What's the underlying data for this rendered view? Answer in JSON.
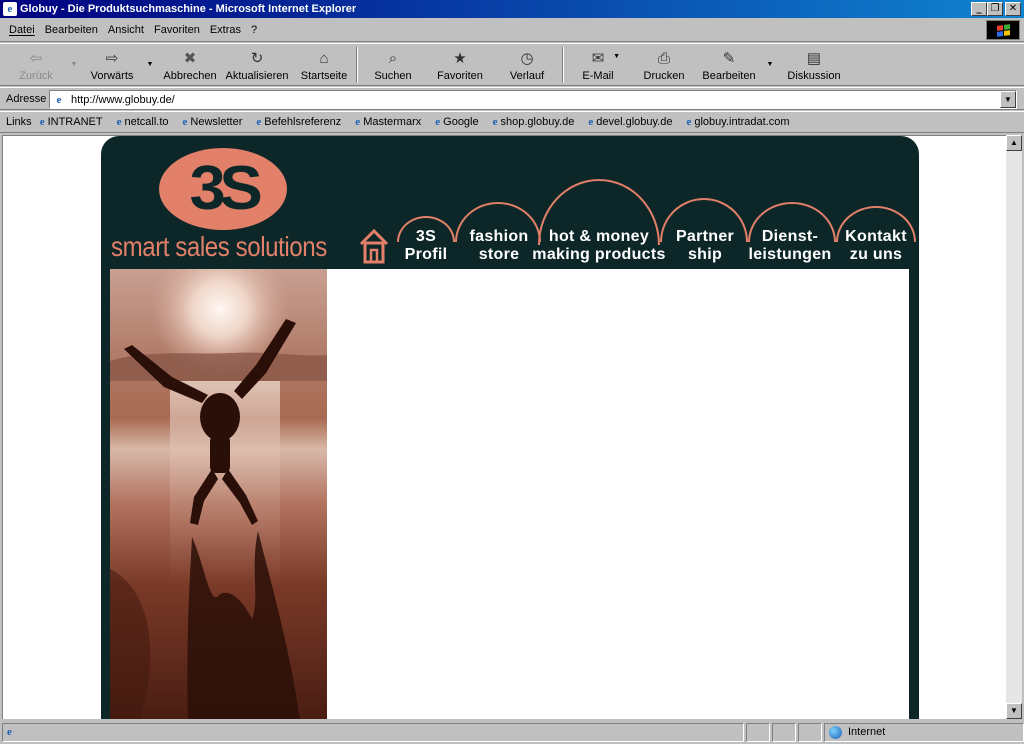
{
  "window": {
    "title": "Globuy - Die Produktsuchmaschine - Microsoft Internet Explorer",
    "minimize": "_",
    "restore": "❐",
    "close": "✕"
  },
  "menu": [
    "Datei",
    "Bearbeiten",
    "Ansicht",
    "Favoriten",
    "Extras",
    "?"
  ],
  "toolbar": [
    {
      "label": "Zurück",
      "icon": "back-arrow-icon",
      "glyph": "⇦",
      "disabled": true,
      "dropdown": true
    },
    {
      "label": "Vorwärts",
      "icon": "forward-arrow-icon",
      "glyph": "⇨",
      "disabled": false,
      "dropdown": true
    },
    {
      "label": "Abbrechen",
      "icon": "stop-icon",
      "glyph": "✖",
      "disabled": false
    },
    {
      "label": "Aktualisieren",
      "icon": "refresh-icon",
      "glyph": "↻",
      "disabled": false
    },
    {
      "label": "Startseite",
      "icon": "home-icon",
      "glyph": "⌂",
      "disabled": false
    },
    {
      "label": "Suchen",
      "icon": "search-icon",
      "glyph": "⌕",
      "disabled": false
    },
    {
      "label": "Favoriten",
      "icon": "favorites-folder-icon",
      "glyph": "★",
      "disabled": false
    },
    {
      "label": "Verlauf",
      "icon": "history-icon",
      "glyph": "◷",
      "disabled": false
    },
    {
      "label": "E-Mail",
      "icon": "mail-icon",
      "glyph": "✉",
      "disabled": false,
      "dropdown": true
    },
    {
      "label": "Drucken",
      "icon": "printer-icon",
      "glyph": "⎙",
      "disabled": false
    },
    {
      "label": "Bearbeiten",
      "icon": "edit-icon",
      "glyph": "✎",
      "disabled": false,
      "dropdown": true
    },
    {
      "label": "Diskussion",
      "icon": "discussion-icon",
      "glyph": "▤",
      "disabled": false
    }
  ],
  "address": {
    "label": "Adresse",
    "url": "http://www.globuy.de/"
  },
  "links": {
    "label": "Links",
    "items": [
      "INTRANET",
      "netcall.to",
      "Newsletter",
      "Befehlsreferenz",
      "Mastermarx",
      "Google",
      "shop.globuy.de",
      "devel.globuy.de",
      "globuy.intradat.com"
    ]
  },
  "site": {
    "logo_text": "3S",
    "tagline": "smart sales solutions",
    "nav": [
      {
        "line1": "3S",
        "line2": "Profil"
      },
      {
        "line1": "fashion",
        "line2": "store"
      },
      {
        "line1": "hot & money",
        "line2": "making products"
      },
      {
        "line1": "Partner",
        "line2": "ship"
      },
      {
        "line1": "Dienst-",
        "line2": "leistungen"
      },
      {
        "line1": "Kontakt",
        "line2": "zu uns"
      }
    ],
    "colors": {
      "background": "#0d2728",
      "accent": "#e2806a"
    }
  },
  "status": {
    "zone": "Internet"
  }
}
